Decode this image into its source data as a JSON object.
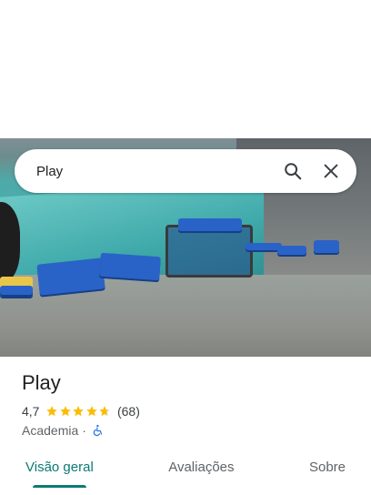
{
  "search": {
    "query": "Play",
    "search_icon": "search-icon",
    "close_icon": "close-icon"
  },
  "place": {
    "name": "Play",
    "rating": "4,7",
    "rating_value": 4.7,
    "review_count": "(68)",
    "category": "Academia",
    "separator": "·",
    "accessibility_icon": "wheelchair-icon"
  },
  "tabs": [
    {
      "label": "Visão geral",
      "active": true
    },
    {
      "label": "Avaliações",
      "active": false
    },
    {
      "label": "Sobre",
      "active": false
    }
  ],
  "colors": {
    "accent": "#0b7a75",
    "star": "#fbbc04",
    "accessibility": "#1a73e8"
  }
}
